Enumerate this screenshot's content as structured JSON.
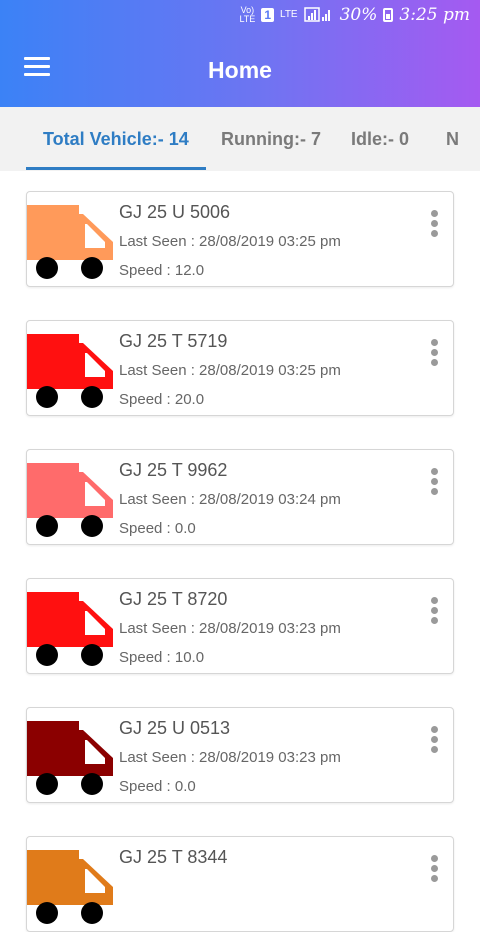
{
  "status_bar": {
    "network": "Vo))\nLTE",
    "sim": "1",
    "lte": "LTE",
    "battery_pct": "30%",
    "time": "3:25 pm"
  },
  "appbar": {
    "title": "Home"
  },
  "tabs": [
    {
      "label": "Total Vehicle:- 14",
      "active": true
    },
    {
      "label": "Running:- 7",
      "active": false
    },
    {
      "label": "Idle:- 0",
      "active": false
    },
    {
      "label": "N",
      "active": false
    }
  ],
  "vehicles": [
    {
      "number": "GJ 25 U 5006",
      "last_seen": "Last Seen : 28/08/2019 03:25 pm",
      "speed": "Speed : 12.0",
      "color": "#ff9a5a"
    },
    {
      "number": "GJ 25 T 5719",
      "last_seen": "Last Seen : 28/08/2019 03:25 pm",
      "speed": "Speed : 20.0",
      "color": "#ff1010"
    },
    {
      "number": "GJ 25 T 9962",
      "last_seen": "Last Seen : 28/08/2019 03:24 pm",
      "speed": "Speed : 0.0",
      "color": "#ff6b6b"
    },
    {
      "number": "GJ 25 T 8720",
      "last_seen": "Last Seen : 28/08/2019 03:23 pm",
      "speed": "Speed : 10.0",
      "color": "#ff1010"
    },
    {
      "number": "GJ 25 U 0513",
      "last_seen": "Last Seen : 28/08/2019 03:23 pm",
      "speed": "Speed : 0.0",
      "color": "#8b0000"
    },
    {
      "number": "GJ 25 T 8344",
      "last_seen": "",
      "speed": "",
      "color": "#e07b1a"
    }
  ],
  "icons": {
    "menu": "hamburger-menu-icon",
    "kebab": "more-vert-icon",
    "vehicle": "truck-icon"
  }
}
